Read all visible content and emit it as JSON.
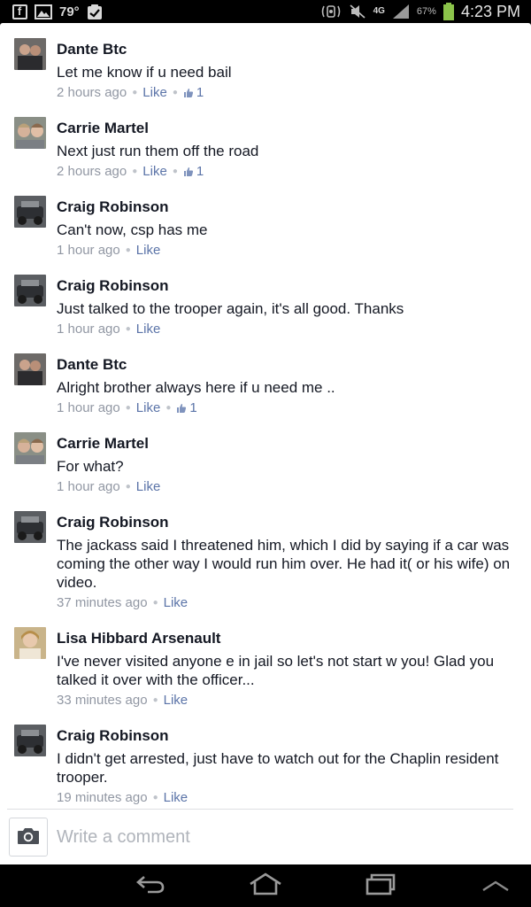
{
  "status_bar": {
    "temperature": "79°",
    "network": "4G",
    "battery": "67%",
    "time": "4:23 PM",
    "icons": [
      "facebook-icon",
      "image-icon",
      "clipboard-check-icon",
      "nfc-icon",
      "mute-icon",
      "signal-icon",
      "battery-icon"
    ]
  },
  "comments": [
    {
      "name": "Dante Btc",
      "text": "Let me know if u need bail",
      "time": "2 hours ago",
      "like_label": "Like",
      "likes": "1"
    },
    {
      "name": "Carrie Martel",
      "text": "Next just run them off the road",
      "time": "2 hours ago",
      "like_label": "Like",
      "likes": "1"
    },
    {
      "name": "Craig Robinson",
      "text": "Can't now, csp has me",
      "time": "1 hour ago",
      "like_label": "Like"
    },
    {
      "name": "Craig Robinson",
      "text": "Just talked to the trooper again, it's all good. Thanks",
      "time": "1 hour ago",
      "like_label": "Like"
    },
    {
      "name": "Dante Btc",
      "text": "Alright brother always here if u need me ..",
      "time": "1 hour ago",
      "like_label": "Like",
      "likes": "1"
    },
    {
      "name": "Carrie Martel",
      "text": "For what?",
      "time": "1 hour ago",
      "like_label": "Like"
    },
    {
      "name": "Craig Robinson",
      "text": "The jackass said I threatened him, which I did by saying if a car was coming the other way I would run him over. He had it( or his wife) on video.",
      "time": "37 minutes ago",
      "like_label": "Like"
    },
    {
      "name": "Lisa Hibbard Arsenault",
      "text": "I've never visited anyone e in jail so let's not start w you! Glad you talked it over with the officer...",
      "time": "33 minutes ago",
      "like_label": "Like"
    },
    {
      "name": "Craig Robinson",
      "text": "I didn't get arrested, just have to watch out for the Chaplin resident trooper.",
      "time": "19 minutes ago",
      "like_label": "Like"
    }
  ],
  "composer": {
    "placeholder": "Write a comment"
  },
  "colors": {
    "link": "#5b74a8",
    "meta": "#9197a3",
    "text": "#141823"
  }
}
